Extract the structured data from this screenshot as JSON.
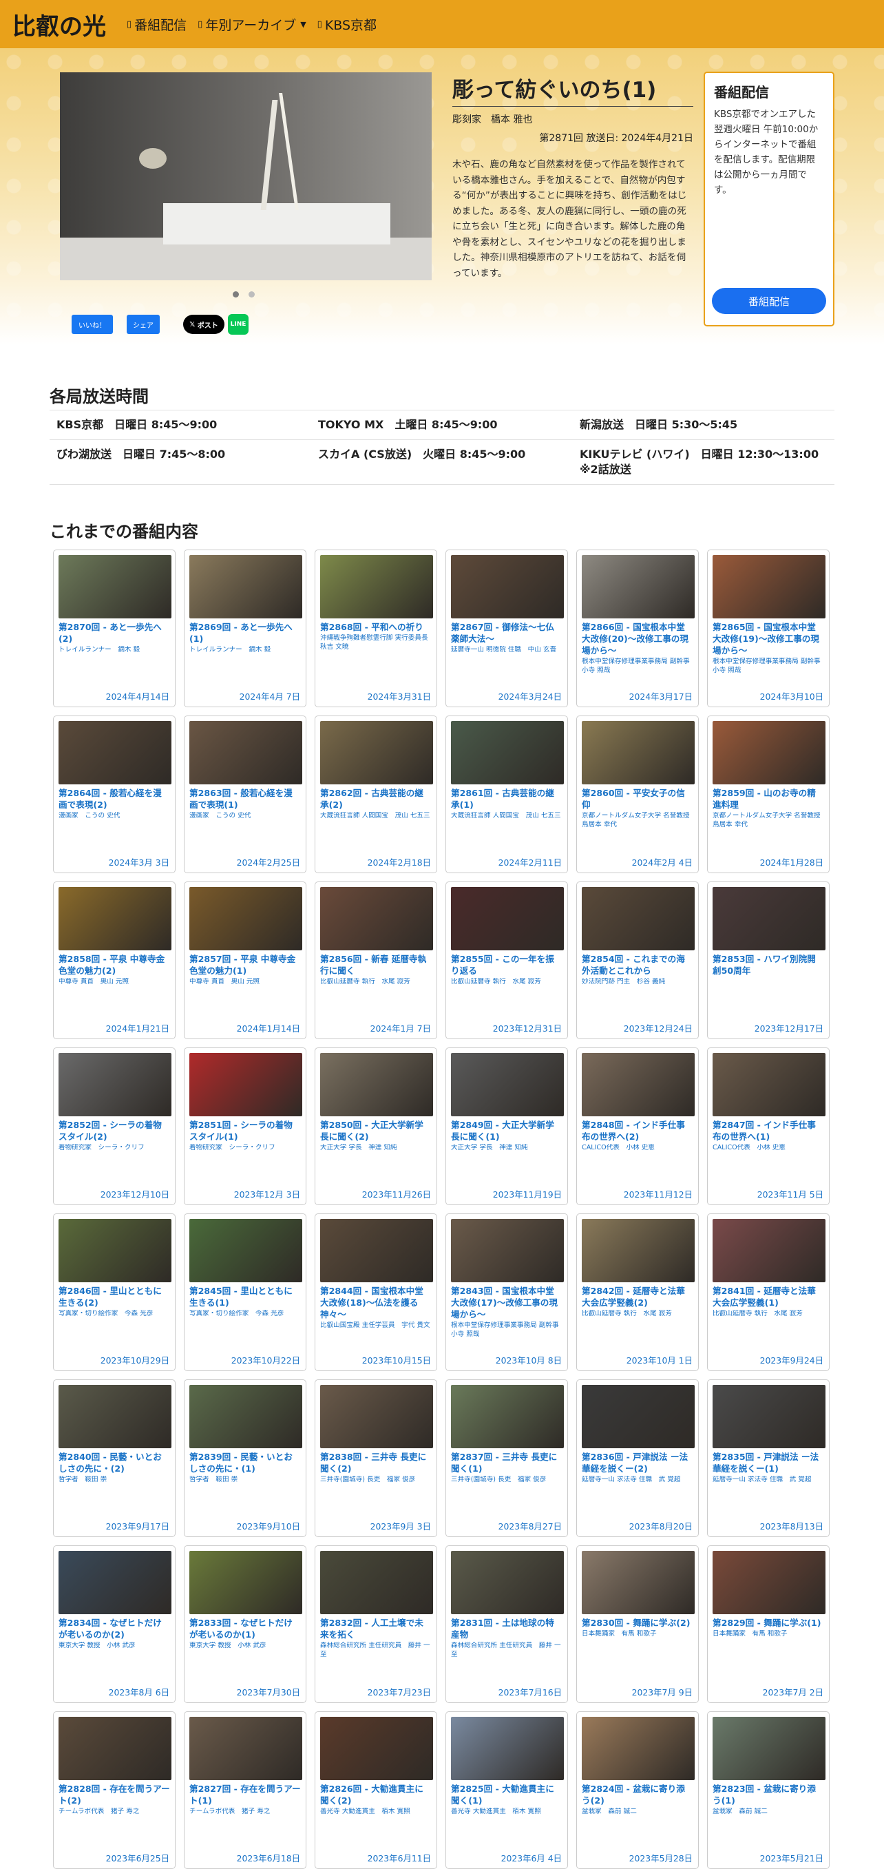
{
  "header": {
    "brand": "比叡の光",
    "nav": [
      {
        "label": "番組配信",
        "icon": "square-icon"
      },
      {
        "label": "年別アーカイブ",
        "icon": "square-icon",
        "dropdown": true
      },
      {
        "label": "KBS京都",
        "icon": "square-icon"
      }
    ]
  },
  "hero": {
    "title": "彫って紡ぐいのち(1)",
    "guest": "彫刻家　橋本 雅也",
    "airing": "第2871回 放送日: 2024年4月21日",
    "description": "木や石、鹿の角など自然素材を使って作品を製作されている橋本雅也さん。手を加えることで、自然物が内包する“何か”が表出することに興味を持ち、創作活動をはじめました。ある冬、友人の鹿猟に同行し、一頭の鹿の死に立ち会い「生と死」に向き合います。解体した鹿の角や骨を素材とし、スイセンやユリなどの花を掘り出しました。神奈川県相模原市のアトリエを訪ねて、お話を伺っています。",
    "slide_count": 2,
    "active_slide": 1
  },
  "distribution": {
    "title": "番組配信",
    "text": "KBS京都でオンエアした翌週火曜日 午前10:00からインターネットで番組を配信します。配信期限は公開から一ヵ月間です。",
    "button": "番組配信"
  },
  "share": {
    "fb_like": "いいね！",
    "fb_share": "シェア",
    "x_post": "ポスト",
    "line": "LINE"
  },
  "broadcast": {
    "title": "各局放送時間",
    "rows": [
      [
        "KBS京都　日曜日 8:45〜9:00",
        "TOKYO MX　土曜日 8:45〜9:00",
        "新潟放送　日曜日 5:30〜5:45"
      ],
      [
        "びわ湖放送　日曜日 7:45〜8:00",
        "スカイA (CS放送)　火曜日 8:45〜9:00",
        "KIKUテレビ (ハワイ)　日曜日 12:30〜13:00\n※2話放送"
      ]
    ]
  },
  "archive": {
    "title": "これまでの番組内容",
    "episodes": [
      {
        "title": "第2870回 - あと一歩先へ(2)",
        "guest": "トレイルランナー　鏑木 毅",
        "date": "2024年4月14日",
        "color": "#6d7a5a"
      },
      {
        "title": "第2869回 - あと一歩先へ(1)",
        "guest": "トレイルランナー　鏑木 毅",
        "date": "2024年4月 7日",
        "color": "#8a7a5c"
      },
      {
        "title": "第2868回 - 平和への祈り",
        "guest": "沖縄戦争殉難者慰霊行脚 実行委員長　秋吉 文暁",
        "date": "2024年3月31日",
        "color": "#7e8a4a"
      },
      {
        "title": "第2867回 - 御修法〜七仏薬師大法〜",
        "guest": "延暦寺一山 明徳院 住職　中山 玄晋",
        "date": "2024年3月24日",
        "color": "#5e4a3a"
      },
      {
        "title": "第2866回 - 国宝根本中堂大改修(20)〜改修工事の現場から〜",
        "guest": "根本中堂保存修理事業事務局 副幹事　小寺 照哉",
        "date": "2024年3月17日",
        "color": "#8e8a82"
      },
      {
        "title": "第2865回 - 国宝根本中堂大改修(19)〜改修工事の現場から〜",
        "guest": "根本中堂保存修理事業事務局 副幹事　小寺 照哉",
        "date": "2024年3月10日",
        "color": "#9a5a3a"
      },
      {
        "title": "第2864回 - 般若心経を漫画で表現(2)",
        "guest": "漫画家　こうの 史代",
        "date": "2024年3月 3日",
        "color": "#5a4a3a"
      },
      {
        "title": "第2863回 - 般若心経を漫画で表現(1)",
        "guest": "漫画家　こうの 史代",
        "date": "2024年2月25日",
        "color": "#6a5644"
      },
      {
        "title": "第2862回 - 古典芸能の継承(2)",
        "guest": "大蔵流狂言師 人間国宝　茂山 七五三",
        "date": "2024年2月18日",
        "color": "#7a6a4a"
      },
      {
        "title": "第2861回 - 古典芸能の継承(1)",
        "guest": "大蔵流狂言師 人間国宝　茂山 七五三",
        "date": "2024年2月11日",
        "color": "#4a5a4a"
      },
      {
        "title": "第2860回 - 平安女子の信仰",
        "guest": "京都ノートルダム女子大学 名誉教授　烏居本 幸代",
        "date": "2024年2月 4日",
        "color": "#8a7a52"
      },
      {
        "title": "第2859回 - 山のお寺の精進料理",
        "guest": "京都ノートルダム女子大学 名誉教授　烏居本 幸代",
        "date": "2024年1月28日",
        "color": "#9a5a3a"
      },
      {
        "title": "第2858回 - 平泉 中尊寺金色堂の魅力(2)",
        "guest": "中尊寺 貫首　奥山 元照",
        "date": "2024年1月21日",
        "color": "#8a6a2a"
      },
      {
        "title": "第2857回 - 平泉 中尊寺金色堂の魅力(1)",
        "guest": "中尊寺 貫首　奥山 元照",
        "date": "2024年1月14日",
        "color": "#7a5a2a"
      },
      {
        "title": "第2856回 - 新春 延暦寺執行に聞く",
        "guest": "比叡山延暦寺 執行　水尾 寂芳",
        "date": "2024年1月 7日",
        "color": "#6a4a3a"
      },
      {
        "title": "第2855回 - この一年を振り返る",
        "guest": "比叡山延暦寺 執行　水尾 寂芳",
        "date": "2023年12月31日",
        "color": "#4a2a2a"
      },
      {
        "title": "第2854回 - これまでの海外活動とこれから",
        "guest": "妙法院門跡 門主　杉谷 義純",
        "date": "2023年12月24日",
        "color": "#5a4a3a"
      },
      {
        "title": "第2853回 - ハワイ別院開創50周年",
        "guest": "",
        "date": "2023年12月17日",
        "color": "#4a3a3a"
      },
      {
        "title": "第2852回 - シーラの着物スタイル(2)",
        "guest": "着物研究家　シーラ・クリフ",
        "date": "2023年12月10日",
        "color": "#6a6a6a"
      },
      {
        "title": "第2851回 - シーラの着物スタイル(1)",
        "guest": "着物研究家　シーラ・クリフ",
        "date": "2023年12月 3日",
        "color": "#b02a2a"
      },
      {
        "title": "第2850回 - 大正大学新学長に聞く(2)",
        "guest": "大正大学 学長　神達 知純",
        "date": "2023年11月26日",
        "color": "#7a7060"
      },
      {
        "title": "第2849回 - 大正大学新学長に聞く(1)",
        "guest": "大正大学 学長　神達 知純",
        "date": "2023年11月19日",
        "color": "#5a5a5a"
      },
      {
        "title": "第2848回 - インド手仕事布の世界へ(2)",
        "guest": "CALICO代表　小林 史恵",
        "date": "2023年11月12日",
        "color": "#7a6a5a"
      },
      {
        "title": "第2847回 - インド手仕事布の世界へ(1)",
        "guest": "CALICO代表　小林 史恵",
        "date": "2023年11月 5日",
        "color": "#6a5a4a"
      },
      {
        "title": "第2846回 - 里山とともに生きる(2)",
        "guest": "写真家・切り絵作家　今森 光彦",
        "date": "2023年10月29日",
        "color": "#5a6a3a"
      },
      {
        "title": "第2845回 - 里山とともに生きる(1)",
        "guest": "写真家・切り絵作家　今森 光彦",
        "date": "2023年10月22日",
        "color": "#4a6a3a"
      },
      {
        "title": "第2844回 - 国宝根本中堂大改修(18)〜仏法を護る神々〜",
        "guest": "比叡山国宝殿 主任学芸員　宇代 貴文",
        "date": "2023年10月15日",
        "color": "#5a4a3a"
      },
      {
        "title": "第2843回 - 国宝根本中堂大改修(17)〜改修工事の現場から〜",
        "guest": "根本中堂保存修理事業事務局 副幹事　小寺 照哉",
        "date": "2023年10月 8日",
        "color": "#6a5a4a"
      },
      {
        "title": "第2842回 - 延暦寺と法華大会広学竪義(2)",
        "guest": "比叡山延暦寺 執行　水尾 寂芳",
        "date": "2023年10月 1日",
        "color": "#8a7a5a"
      },
      {
        "title": "第2841回 - 延暦寺と法華大会広学竪義(1)",
        "guest": "比叡山延暦寺 執行　水尾 寂芳",
        "date": "2023年9月24日",
        "color": "#7a4a4a"
      },
      {
        "title": "第2840回 - 民藝・いとおしさの先に・(2)",
        "guest": "哲学者　鞍田 崇",
        "date": "2023年9月17日",
        "color": "#5a5a4a"
      },
      {
        "title": "第2839回 - 民藝・いとおしさの先に・(1)",
        "guest": "哲学者　鞍田 崇",
        "date": "2023年9月10日",
        "color": "#5a6a4a"
      },
      {
        "title": "第2838回 - 三井寺 長吏に聞く(2)",
        "guest": "三井寺(園城寺) 長吏　福家 俊彦",
        "date": "2023年9月 3日",
        "color": "#6a5a4a"
      },
      {
        "title": "第2837回 - 三井寺 長吏に聞く(1)",
        "guest": "三井寺(園城寺) 長吏　福家 俊彦",
        "date": "2023年8月27日",
        "color": "#6a7a5a"
      },
      {
        "title": "第2836回 - 戸津説法 ー法華経を説くー(2)",
        "guest": "延暦寺一山 求法寺 住職　武 覚超",
        "date": "2023年8月20日",
        "color": "#3a3a3a"
      },
      {
        "title": "第2835回 - 戸津説法 ー法華経を説くー(1)",
        "guest": "延暦寺一山 求法寺 住職　武 覚超",
        "date": "2023年8月13日",
        "color": "#4a4a4a"
      },
      {
        "title": "第2834回 - なぜヒトだけが老いるのか(2)",
        "guest": "東京大学 教授　小林 武彦",
        "date": "2023年8月 6日",
        "color": "#3a4a5a"
      },
      {
        "title": "第2833回 - なぜヒトだけが老いるのか(1)",
        "guest": "東京大学 教授　小林 武彦",
        "date": "2023年7月30日",
        "color": "#6a7a3a"
      },
      {
        "title": "第2832回 - 人工土壌で未来を拓く",
        "guest": "森林総合研究所 主任研究員　藤井 一至",
        "date": "2023年7月23日",
        "color": "#4a4a3a"
      },
      {
        "title": "第2831回 - 土は地球の特産物",
        "guest": "森林総合研究所 主任研究員　藤井 一至",
        "date": "2023年7月16日",
        "color": "#5a5a4a"
      },
      {
        "title": "第2830回 - 舞踊に学ぶ(2)",
        "guest": "日本舞踊家　有馬 和歌子",
        "date": "2023年7月 9日",
        "color": "#8a7a6a"
      },
      {
        "title": "第2829回 - 舞踊に学ぶ(1)",
        "guest": "日本舞踊家　有馬 和歌子",
        "date": "2023年7月 2日",
        "color": "#7a4a3a"
      },
      {
        "title": "第2828回 - 存在を問うアート(2)",
        "guest": "チームラボ代表　猪子 寿之",
        "date": "2023年6月25日",
        "color": "#5a4a3a"
      },
      {
        "title": "第2827回 - 存在を問うアート(1)",
        "guest": "チームラボ代表　猪子 寿之",
        "date": "2023年6月18日",
        "color": "#6a5a4a"
      },
      {
        "title": "第2826回 - 大勧進貫主に聞く(2)",
        "guest": "善光寺 大勧進貫主　栢木 寛照",
        "date": "2023年6月11日",
        "color": "#5a3a2a"
      },
      {
        "title": "第2825回 - 大勧進貫主に聞く(1)",
        "guest": "善光寺 大勧進貫主　栢木 寛照",
        "date": "2023年6月 4日",
        "color": "#7a8aa0"
      },
      {
        "title": "第2824回 - 盆栽に寄り添う(2)",
        "guest": "盆栽家　森前 誠二",
        "date": "2023年5月28日",
        "color": "#9a7a5a"
      },
      {
        "title": "第2823回 - 盆栽に寄り添う(1)",
        "guest": "盆栽家　森前 誠二",
        "date": "2023年5月21日",
        "color": "#6a7a6a"
      }
    ]
  }
}
